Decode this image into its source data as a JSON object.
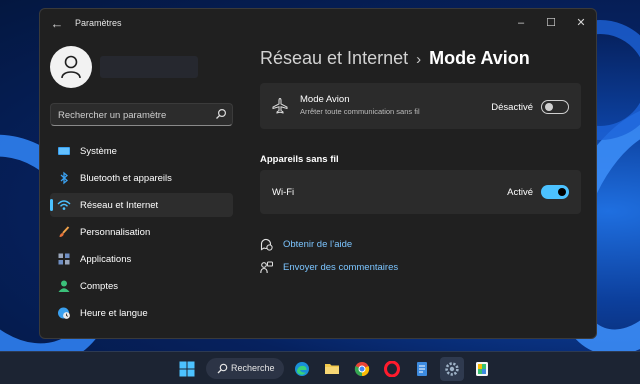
{
  "window": {
    "title": "Paramètres",
    "back_icon": "back-arrow-icon",
    "controls": {
      "minimize": "–",
      "maximize": "☐",
      "close": "✕"
    }
  },
  "sidebar": {
    "search": {
      "placeholder": "Rechercher un paramètre",
      "value": ""
    },
    "items": [
      {
        "label": "Système",
        "icon": "display-icon",
        "selected": false
      },
      {
        "label": "Bluetooth et appareils",
        "icon": "bluetooth-icon",
        "selected": false
      },
      {
        "label": "Réseau et Internet",
        "icon": "wifi-icon",
        "selected": true
      },
      {
        "label": "Personnalisation",
        "icon": "brush-icon",
        "selected": false
      },
      {
        "label": "Applications",
        "icon": "apps-icon",
        "selected": false
      },
      {
        "label": "Comptes",
        "icon": "person-icon",
        "selected": false
      },
      {
        "label": "Heure et langue",
        "icon": "globe-clock-icon",
        "selected": false
      }
    ]
  },
  "main": {
    "breadcrumb": {
      "parent": "Réseau et Internet",
      "separator": "›",
      "current": "Mode Avion"
    },
    "airplane_card": {
      "title": "Mode Avion",
      "subtitle": "Arrêter toute communication sans fil",
      "state": "Désactivé",
      "toggle_on": false
    },
    "wireless_section_title": "Appareils sans fil",
    "wifi_card": {
      "label": "Wi-Fi",
      "state": "Activé",
      "toggle_on": true
    },
    "links": {
      "help": "Obtenir de l’aide",
      "feedback": "Envoyer des commentaires"
    }
  },
  "taskbar": {
    "search_label": "Recherche",
    "apps": [
      "start-icon",
      "edge-icon",
      "file-explorer-icon",
      "chrome-icon",
      "opera-icon",
      "notepad-icon",
      "settings-icon",
      "paint-icon"
    ]
  },
  "colors": {
    "accent": "#4cc2ff",
    "window_bg": "#202020",
    "card_bg": "#2b2b2b",
    "link": "#7cc5ff"
  }
}
